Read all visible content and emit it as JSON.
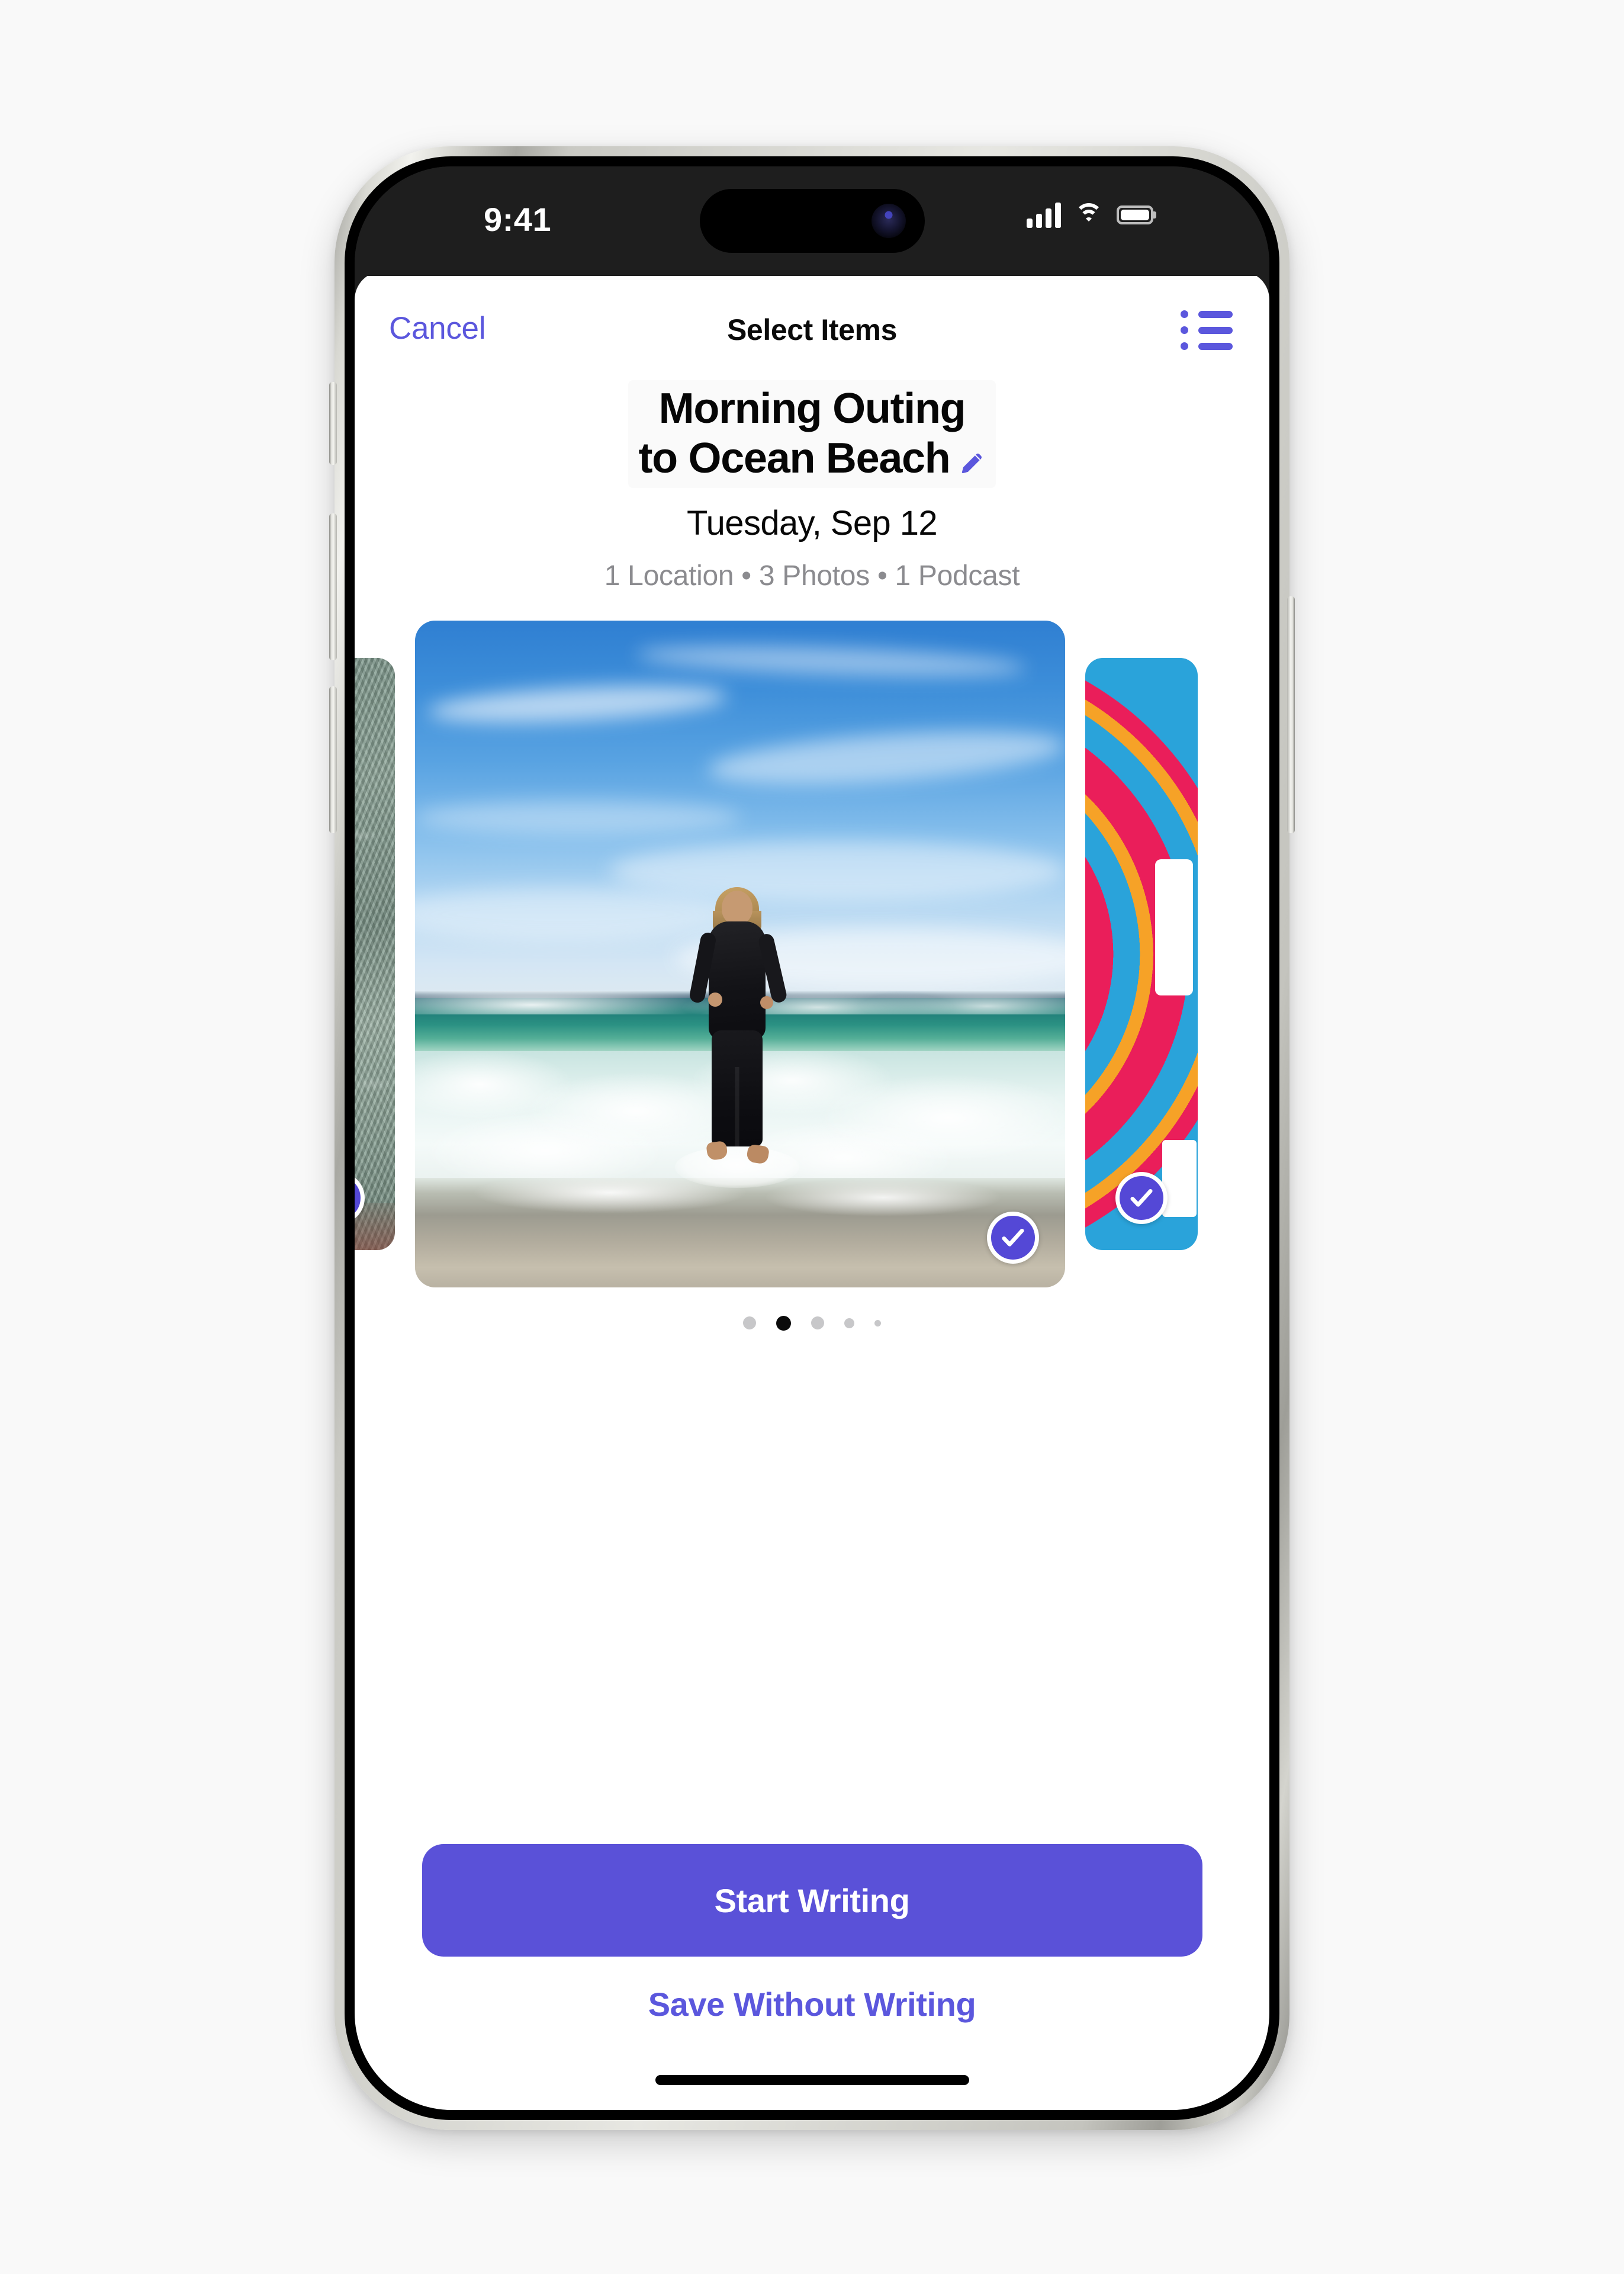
{
  "status_bar": {
    "time": "9:41",
    "signal_icon": "cellular-signal-icon",
    "wifi_icon": "wifi-icon",
    "battery_icon": "battery-icon"
  },
  "nav": {
    "cancel_label": "Cancel",
    "title": "Select Items",
    "list_icon": "bulleted-list-icon"
  },
  "entry": {
    "title_line1": "Morning Outing",
    "title_line2": "to Ocean Beach",
    "edit_icon": "pencil-icon",
    "date": "Tuesday, Sep 12",
    "meta": "1 Location • 3 Photos • 1 Podcast"
  },
  "carousel": {
    "items": [
      {
        "name": "photo-card-rock",
        "kind": "photo",
        "selected": true,
        "check_icon": "check-icon"
      },
      {
        "name": "photo-card-beach-runner",
        "kind": "photo",
        "selected": true,
        "check_icon": "check-icon"
      },
      {
        "name": "podcast-card-artwork",
        "kind": "podcast",
        "selected": true,
        "check_icon": "check-icon"
      }
    ],
    "page_count": 5,
    "active_page": 2
  },
  "footer": {
    "primary_label": "Start Writing",
    "secondary_label": "Save Without Writing"
  },
  "colors": {
    "accent_purple": "#5b57dd",
    "button_purple": "#5a51d8",
    "check_badge_purple": "#5448d6",
    "meta_gray": "#8b8b8f",
    "page_bg": "#f9f9f9",
    "sheet_bg": "#ffffff",
    "status_bar_bg": "#1e1e1e"
  }
}
